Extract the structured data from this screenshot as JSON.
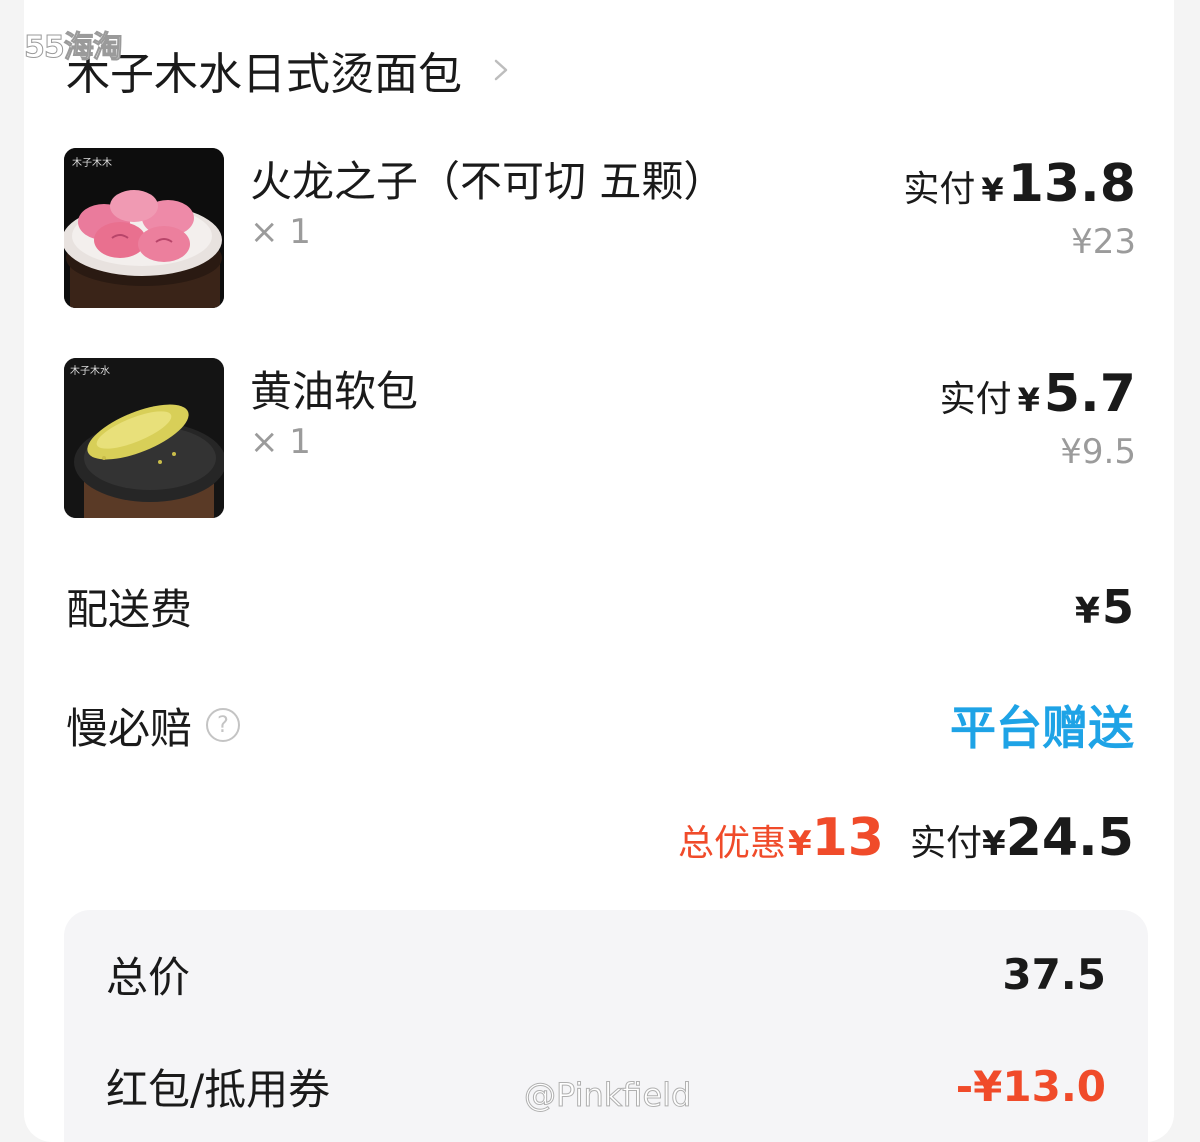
{
  "watermark": "55海淘",
  "shop": {
    "name": "木子木水日式烫面包"
  },
  "items": [
    {
      "name": "火龙之子（不可切 五颗）",
      "qty": "× 1",
      "pay_label": "实付",
      "currency": "¥",
      "pay_amount": "13.8",
      "original_price": "¥23"
    },
    {
      "name": "黄油软包",
      "qty": "× 1",
      "pay_label": "实付",
      "currency": "¥",
      "pay_amount": "5.7",
      "original_price": "¥9.5"
    }
  ],
  "delivery": {
    "label": "配送费",
    "currency": "¥",
    "amount": "5"
  },
  "guarantee": {
    "label": "慢必赔",
    "help": "?",
    "value": "平台赠送"
  },
  "summary": {
    "discount_label": "总优惠",
    "currency": "¥",
    "discount_amount": "13",
    "total_label": "实付",
    "total_amount": "24.5"
  },
  "breakdown": {
    "total_price_label": "总价",
    "total_price": "37.5",
    "coupon_label": "红包/抵用券",
    "coupon_amount": "-¥13.0"
  },
  "footer_watermark": "@Pinkfield",
  "colors": {
    "discount": "#f04b2a",
    "promo": "#1ea3e6"
  }
}
